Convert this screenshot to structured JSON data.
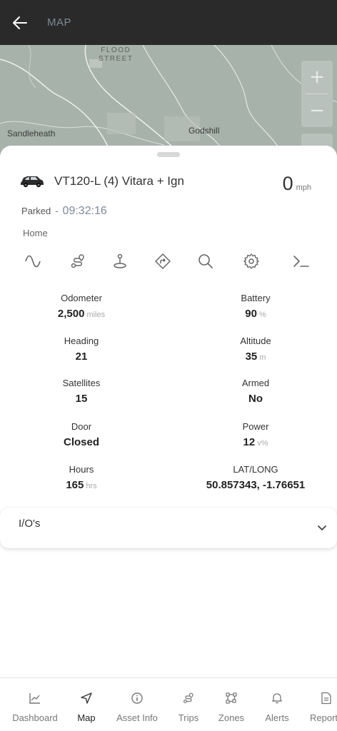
{
  "appbar": {
    "title": "MAP",
    "back_icon": "arrow-left-icon"
  },
  "map": {
    "places": [
      "Sandleheath",
      "Godshill"
    ],
    "street_line1": "FLOOD",
    "street_line2": "STREET",
    "zoom_in": "+",
    "zoom_out": "−"
  },
  "vehicle": {
    "name": "VT120-L (4) Vitara + Ign",
    "speed": "0",
    "speed_unit": "mph",
    "status": "Parked",
    "status_sep": "-",
    "time": "09:32:16",
    "location": "Home"
  },
  "actions": [
    {
      "icon": "wave-icon"
    },
    {
      "icon": "route-icon"
    },
    {
      "icon": "pin-person-icon"
    },
    {
      "icon": "directions-icon"
    },
    {
      "icon": "search-icon"
    },
    {
      "icon": "gear-icon"
    },
    {
      "icon": "terminal-icon"
    }
  ],
  "stats": {
    "odometer": {
      "label": "Odometer",
      "value": "2,500",
      "unit": "miles"
    },
    "battery": {
      "label": "Battery",
      "value": "90",
      "unit": "%"
    },
    "heading": {
      "label": "Heading",
      "value": "21"
    },
    "altitude": {
      "label": "Altitude",
      "value": "35",
      "unit": "m"
    },
    "satellites": {
      "label": "Satellites",
      "value": "15"
    },
    "armed": {
      "label": "Armed",
      "value": "No"
    },
    "door": {
      "label": "Door",
      "value": "Closed"
    },
    "power": {
      "label": "Power",
      "value": "12",
      "unit": "v%"
    },
    "hours": {
      "label": "Hours",
      "value": "165",
      "unit": "hrs"
    },
    "latlong": {
      "label": "LAT/LONG",
      "value": "50.857343, -1.76651"
    }
  },
  "io": {
    "label": "I/O's"
  },
  "nav": {
    "items": [
      {
        "label": "Dashboard",
        "icon": "chart-icon"
      },
      {
        "label": "Map",
        "icon": "navigation-arrow-icon",
        "active": true
      },
      {
        "label": "Asset Info",
        "icon": "info-icon"
      },
      {
        "label": "Trips",
        "icon": "route-icon"
      },
      {
        "label": "Zones",
        "icon": "zone-icon"
      },
      {
        "label": "Alerts",
        "icon": "bell-icon"
      },
      {
        "label": "Report",
        "icon": "document-icon"
      }
    ]
  }
}
